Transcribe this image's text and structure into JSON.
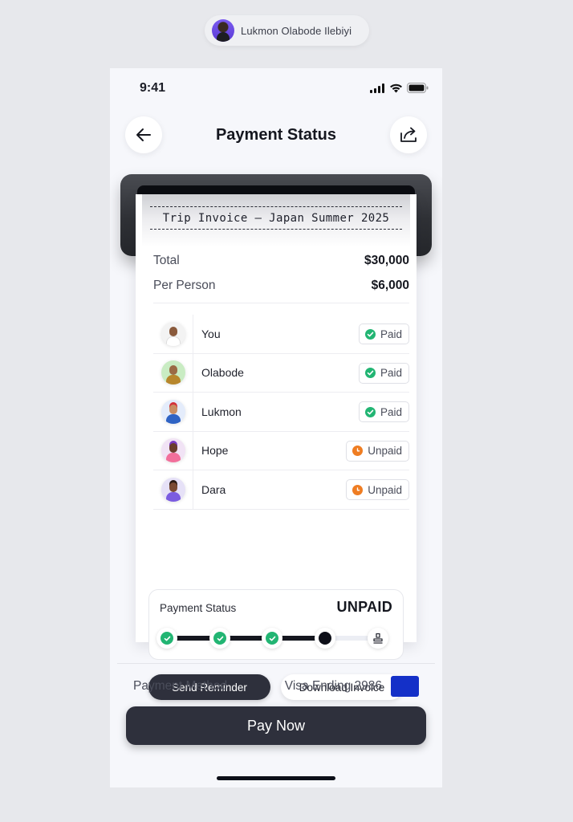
{
  "author": {
    "name": "Lukmon Olabode Ilebiyi"
  },
  "status_bar": {
    "time": "9:41"
  },
  "header": {
    "title": "Payment Status"
  },
  "receipt": {
    "title": "Trip Invoice — Japan Summer 2025",
    "total_label": "Total",
    "total_value": "$30,000",
    "per_person_label": "Per Person",
    "per_person_value": "$6,000",
    "members": [
      {
        "name": "You",
        "status": "Paid"
      },
      {
        "name": "Olabode",
        "status": "Paid"
      },
      {
        "name": "Lukmon",
        "status": "Paid"
      },
      {
        "name": "Hope",
        "status": "Unpaid"
      },
      {
        "name": "Dara",
        "status": "Unpaid"
      }
    ],
    "status_box": {
      "label": "Payment Status",
      "value": "UNPAID",
      "progress": 0.75,
      "steps": [
        "done",
        "done",
        "done",
        "current",
        "final"
      ]
    },
    "send_reminder_label": "Send Reminder",
    "download_invoice_label": "Download Invoice"
  },
  "payment": {
    "method_label": "Payment Method",
    "method_value": "Visa Ending 2986",
    "card_color": "#1430c8",
    "pay_label": "Pay Now"
  },
  "colors": {
    "paid": "#22b573",
    "unpaid": "#ef7d22",
    "dark": "#2e303c"
  }
}
